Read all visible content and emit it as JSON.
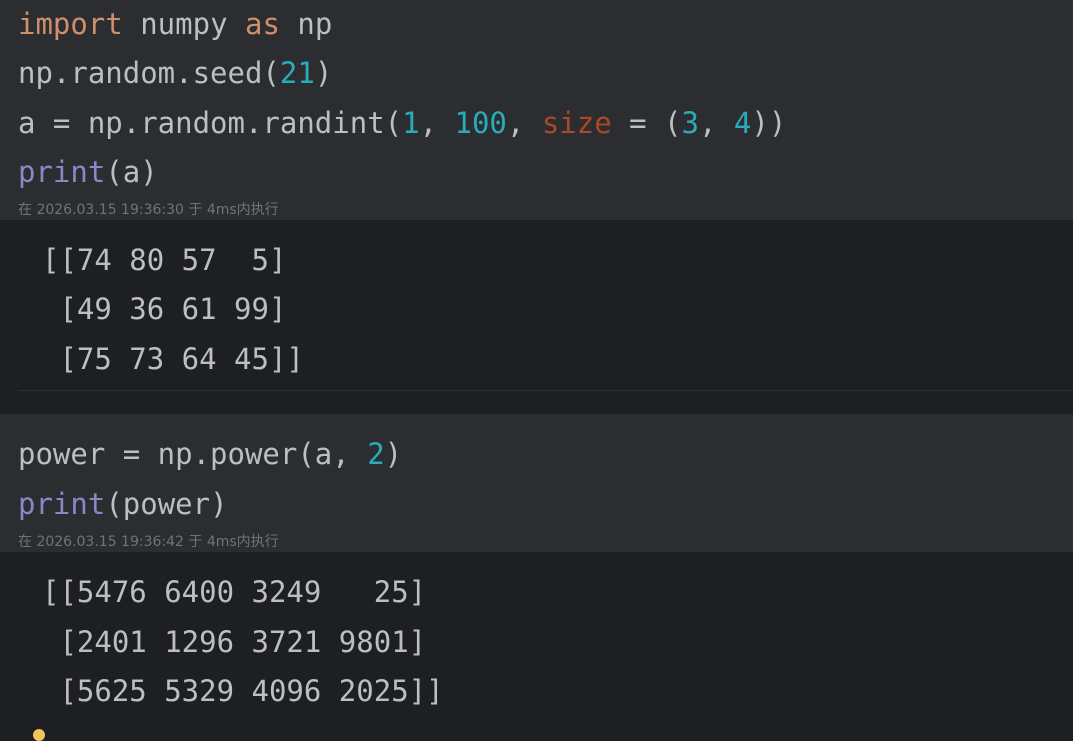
{
  "cell1": {
    "code": {
      "line1": {
        "t1": "import",
        "t2": " numpy ",
        "t3": "as",
        "t4": " np"
      },
      "line2": {
        "t1": "np.random.seed(",
        "t2": "21",
        "t3": ")"
      },
      "line3": {
        "t1": "a = np.random.randint(",
        "t2": "1",
        "t3": ", ",
        "t4": "100",
        "t5": ", ",
        "t6": "size",
        "t7": " = (",
        "t8": "3",
        "t9": ", ",
        "t10": "4",
        "t11": "))"
      },
      "line4": {
        "t1": "print",
        "t2": "(a)"
      }
    },
    "meta": "在 2026.03.15 19:36:30 于 4ms内执行",
    "output": [
      "[[74 80 57  5]",
      " [49 36 61 99]",
      " [75 73 64 45]]"
    ]
  },
  "cell2": {
    "code": {
      "line1": {
        "t1": "power = np.power(a, ",
        "t2": "2",
        "t3": ")"
      },
      "line2": {
        "t1": "print",
        "t2": "(power)"
      }
    },
    "meta": "在 2026.03.15 19:36:42 于 4ms内执行",
    "output": [
      "[[5476 6400 3249   25]",
      " [2401 1296 3721 9801]",
      " [5625 5329 4096 2025]]"
    ]
  },
  "colors": {
    "keyword": "#cf8e6d",
    "number": "#2aacb8",
    "builtin": "#8888c6",
    "parameter": "#aa4926",
    "text": "#bcbec4",
    "status_dot": "#f2c55c"
  }
}
